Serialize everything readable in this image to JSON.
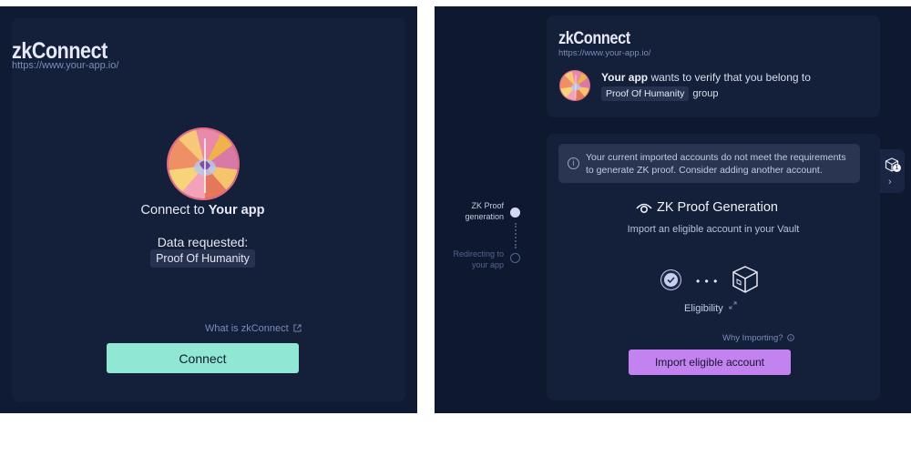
{
  "left": {
    "logo": "zkConnect",
    "url": "https://www.your-app.io/",
    "connect_prefix": "Connect to ",
    "app_name": "Your app",
    "data_requested_label": "Data requested:",
    "group_chip": "Proof Of Humanity",
    "what_link": "What is zkConnect",
    "connect_button": "Connect"
  },
  "right": {
    "logo": "zkConnect",
    "url": "https://www.your-app.io/",
    "app_name": "Your app",
    "verify_text": " wants to verify that you belong to",
    "group_chip": "Proof Of Humanity",
    "group_suffix": "group",
    "warning": "Your current imported accounts do not meet the requirements to generate ZK proof. Consider adding another account.",
    "zk_title": "ZK Proof Generation",
    "zk_subtitle": "Import an eligible account in your Vault",
    "eligibility_label": "Eligibility",
    "why_link": "Why Importing?",
    "import_button": "Import eligible account",
    "steps": [
      {
        "line1": "ZK Proof",
        "line2": "generation",
        "state": "active"
      },
      {
        "line1": "Redirecting to",
        "line2": "your app",
        "state": "pending"
      }
    ],
    "vault_badge": "1",
    "vault_chevron": "›"
  },
  "icons": {
    "external-link": "external-link-icon",
    "info": "info-icon",
    "eye": "eye-icon",
    "check": "check-icon",
    "vault-box": "vault-box-icon",
    "chevron-right": "chevron-right-icon"
  },
  "colors": {
    "background": "#0f1a33",
    "panel": "#141f3a",
    "connect_button": "#8fe7d4",
    "import_button": "#c283f0",
    "chip": "#26324f"
  }
}
